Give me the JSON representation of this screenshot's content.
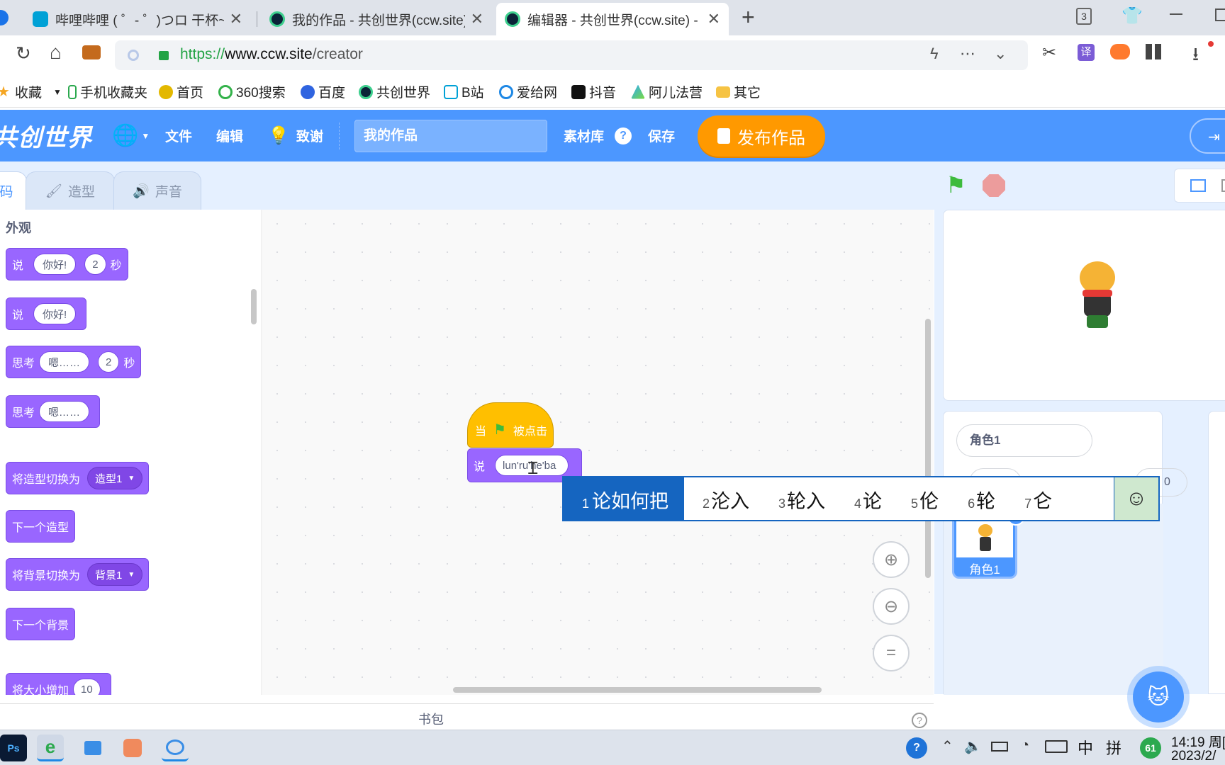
{
  "browser": {
    "tabs": [
      {
        "title": "哔哩哔哩 ( ゜- ゜)つロ 干杯~-b"
      },
      {
        "title": "我的作品 - 共创世界(ccw.site)"
      },
      {
        "title": "编辑器 - 共创世界(ccw.site) -"
      }
    ],
    "tab_count_badge": "3",
    "url_scheme": "https://",
    "url_host": "www.ccw.site",
    "url_path": "/creator",
    "bookmarks": [
      "收藏",
      "手机收藏夹",
      "首页",
      "360搜索",
      "百度",
      "共创世界",
      "B站",
      "爱给网",
      "抖音",
      "阿儿法营",
      "其它"
    ],
    "toolbar_right_labels": {
      "translate": "译"
    }
  },
  "app": {
    "logo": "共创世界",
    "menus": {
      "file": "文件",
      "edit": "编辑",
      "tribute": "致谢"
    },
    "project_title": "我的作品",
    "assets": "素材库",
    "help": "?",
    "save": "保存",
    "publish": "发布作品",
    "editor_tabs": {
      "code": "码",
      "costumes": "造型",
      "sounds": "声音"
    },
    "category_heading": "外观",
    "blocks": {
      "say_secs": {
        "label": "说",
        "text": "你好!",
        "secs": "2",
        "unit": "秒"
      },
      "say": {
        "label": "说",
        "text": "你好!"
      },
      "think_secs": {
        "label": "思考",
        "text": "嗯……",
        "secs": "2",
        "unit": "秒"
      },
      "think": {
        "label": "思考",
        "text": "嗯……"
      },
      "switch_costume": {
        "label": "将造型切换为",
        "value": "造型1"
      },
      "next_costume": {
        "label": "下一个造型"
      },
      "switch_backdrop": {
        "label": "将背景切换为",
        "value": "背景1"
      },
      "next_backdrop": {
        "label": "下一个背景"
      },
      "change_size": {
        "label": "将大小增加",
        "value": "10"
      }
    },
    "script": {
      "hat_when": "当",
      "hat_clicked": "被点击",
      "say_label": "说",
      "say_input": "lun'ru'he'ba"
    },
    "backpack": "书包",
    "sprite": {
      "name_field": "角色1",
      "tile_name": "角色1",
      "partial_value": "0"
    }
  },
  "ime": {
    "candidates": [
      {
        "num": "1",
        "text": "论如何把"
      },
      {
        "num": "2",
        "text": "沦入"
      },
      {
        "num": "3",
        "text": "轮入"
      },
      {
        "num": "4",
        "text": "论"
      },
      {
        "num": "5",
        "text": "伦"
      },
      {
        "num": "6",
        "text": "轮"
      },
      {
        "num": "7",
        "text": "仑"
      }
    ]
  },
  "taskbar": {
    "ps": "Ps",
    "tray_lang": "中",
    "tray_pinyin": "拼",
    "badge": "61",
    "time": "14:19 周[",
    "date": "2023/2/"
  },
  "colors": {
    "brand": "#4c97ff",
    "looks": "#9966ff",
    "events": "#ffbf00",
    "publish": "#ff9900"
  }
}
